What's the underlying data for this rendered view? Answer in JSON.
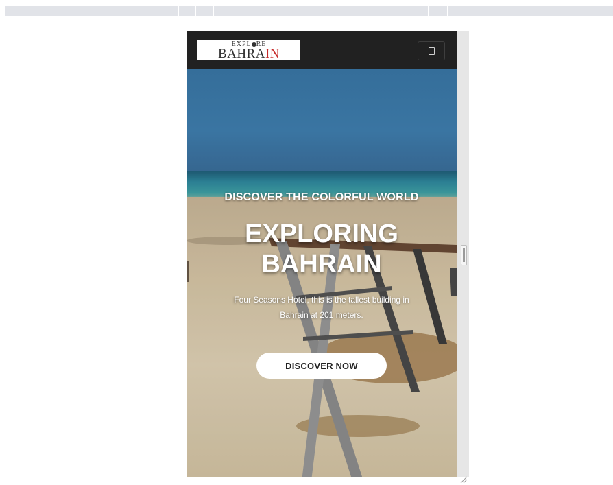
{
  "site": {
    "logo_line1": "EXPL",
    "logo_line1_after": "RE",
    "logo_line2": "BAHRA",
    "logo_line2_red": "IN"
  },
  "hero": {
    "subtitle": "DISCOVER THE COLORFUL WORLD",
    "title_line1": "EXPLORING",
    "title_line2": "BAHRAIN",
    "description": "Four Seasons Hotel, this is the tallest building in Bahrain at 201 meters.",
    "cta_label": "DISCOVER NOW"
  },
  "colors": {
    "navbar": "#212121",
    "cta_bg": "#ffffff",
    "logo_accent": "#c62828",
    "sky": "#3f7fb0",
    "sand": "#d9c8a8"
  },
  "icons": {
    "menu_toggle": "hamburger-menu-icon"
  }
}
